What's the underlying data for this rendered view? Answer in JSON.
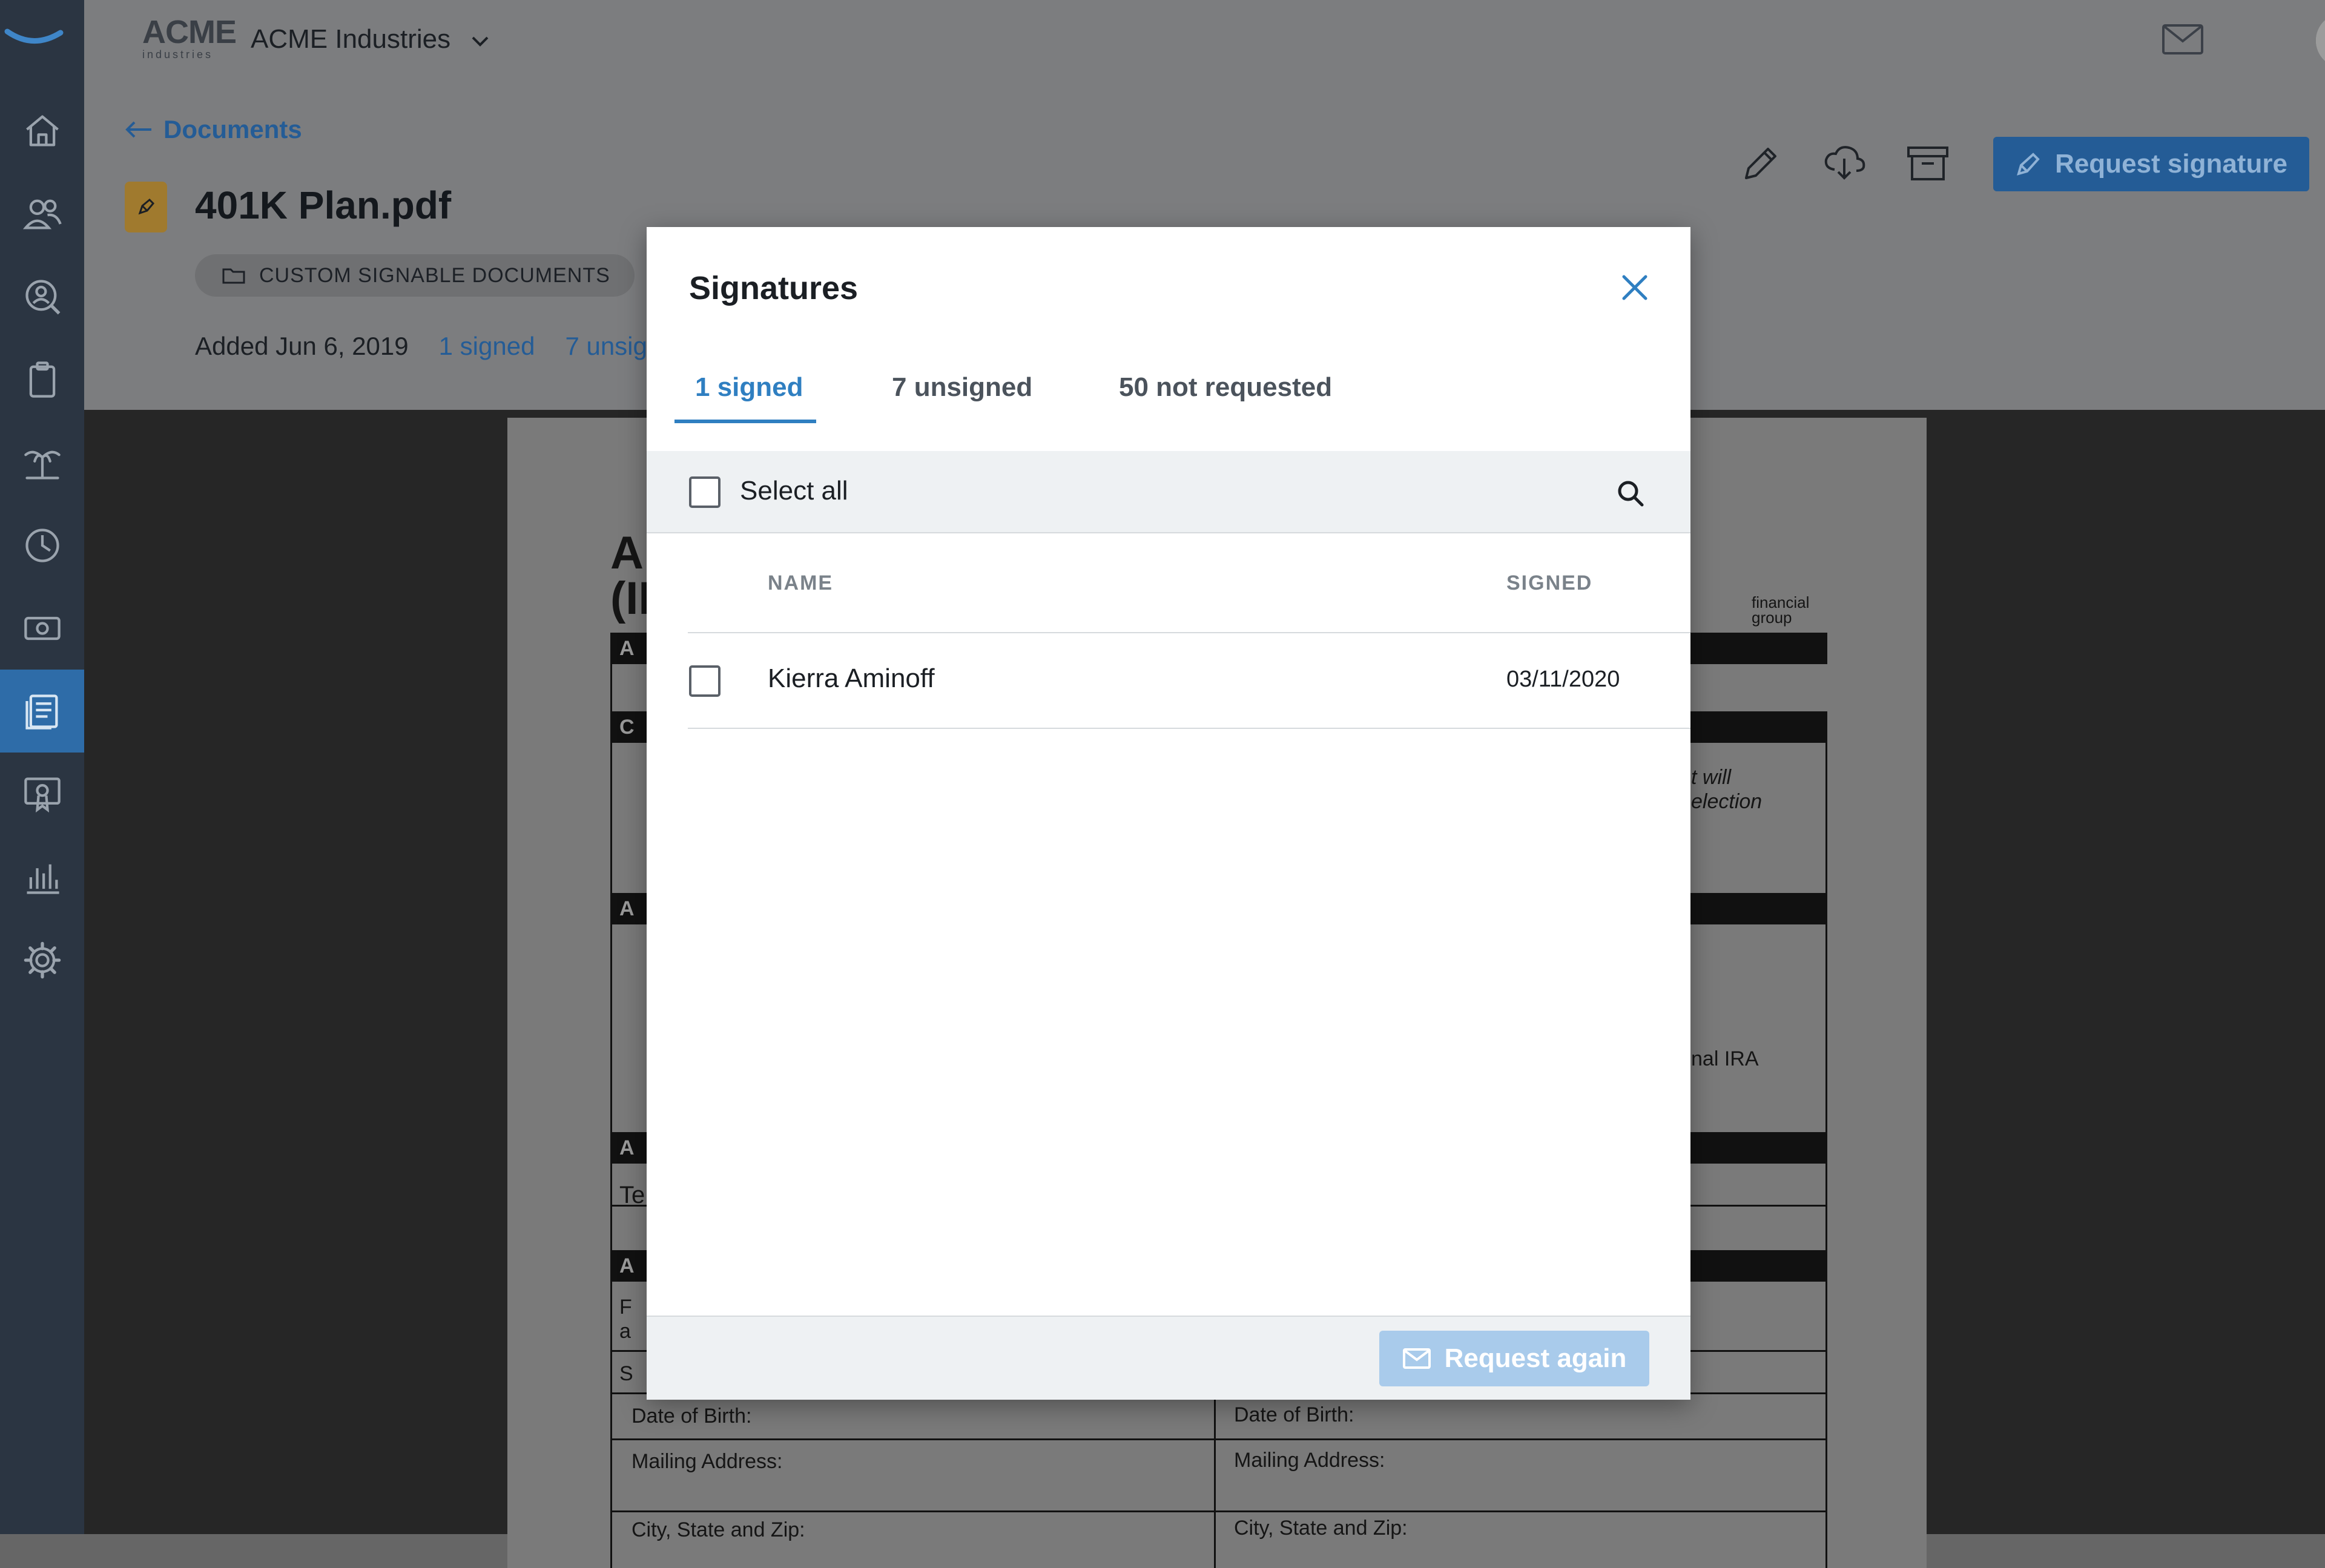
{
  "topbar": {
    "company_logo_text": "ACME",
    "company_logo_sub": "industries",
    "company_name": "ACME Industries"
  },
  "header": {
    "back_label": "Documents",
    "doc_title": "401K Plan.pdf",
    "folder_label": "CUSTOM SIGNABLE DOCUMENTS",
    "added_label": "Added Jun 6, 2019",
    "signed_link": "1 signed",
    "unsigned_link": "7 unsig",
    "request_signature_label": "Request signature"
  },
  "pdf": {
    "heading_a": "A",
    "heading_b": "(II",
    "row_labels": [
      "A",
      "C",
      "A",
      "A",
      "A"
    ],
    "text_te": "Te",
    "text_f": "F",
    "text_a": "a",
    "text_s": "S",
    "dob_left": "Date of Birth:",
    "dob_right": "Date of Birth:",
    "mail_left": "Mailing Address:",
    "mail_right": "Mailing Address:",
    "city_left": "City, State and Zip:",
    "city_right": "City, State and Zip:",
    "right_note_1": "t will",
    "right_note_2": "election",
    "right_ira": "nal IRA",
    "brand_small_1": "financial",
    "brand_small_2": "group"
  },
  "modal": {
    "title": "Signatures",
    "tabs": [
      {
        "label": "1 signed",
        "active": true
      },
      {
        "label": "7 unsigned",
        "active": false
      },
      {
        "label": "50 not requested",
        "active": false
      }
    ],
    "select_all_label": "Select all",
    "columns": {
      "name": "NAME",
      "signed": "SIGNED"
    },
    "rows": [
      {
        "name": "Kierra Aminoff",
        "signed": "03/11/2020"
      }
    ],
    "request_again_label": "Request again"
  },
  "colors": {
    "accent": "#2f7fc1",
    "sidebar_bg": "#2b3542",
    "sidebar_active": "#2e6ca8",
    "overlay_header": "#7c7d7f",
    "disabled_button": "#a9cbeb"
  },
  "icons": {
    "sidebar": [
      "home-icon",
      "people-icon",
      "person-search-icon",
      "clipboard-icon",
      "vacation-icon",
      "clock-icon",
      "money-icon",
      "documents-icon",
      "certificate-icon",
      "reports-icon",
      "settings-icon"
    ],
    "header": [
      "pencil-icon",
      "download-icon",
      "archive-icon",
      "mail-icon"
    ]
  }
}
